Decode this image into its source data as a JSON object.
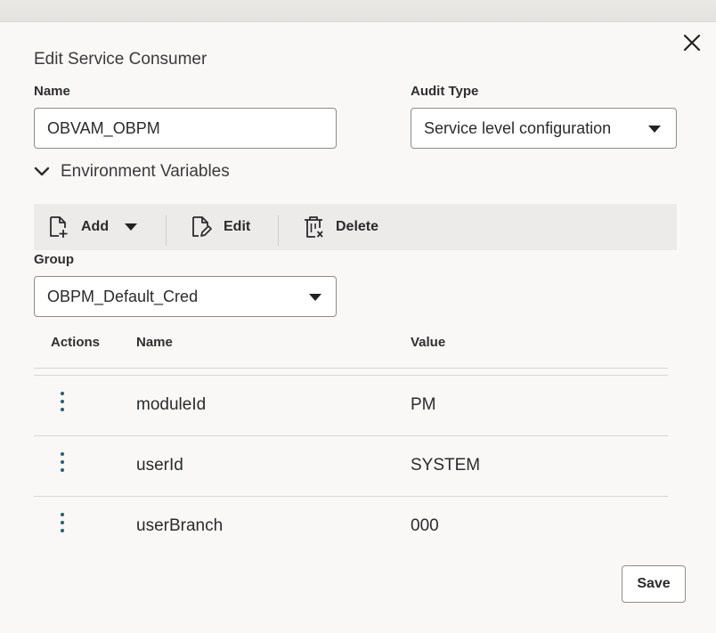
{
  "dialog": {
    "title": "Edit Service Consumer",
    "name_label": "Name",
    "name_value": "OBVAM_OBPM",
    "audit_label": "Audit Type",
    "audit_value": "Service level configuration",
    "env_section_label": "Environment Variables",
    "env_expanded": true
  },
  "toolbar": {
    "add_label": "Add",
    "edit_label": "Edit",
    "delete_label": "Delete"
  },
  "group": {
    "label": "Group",
    "value": "OBPM_Default_Cred"
  },
  "table": {
    "headers": {
      "actions": "Actions",
      "name": "Name",
      "value": "Value"
    },
    "rows": [
      {
        "name": "moduleId",
        "value": "PM"
      },
      {
        "name": "userId",
        "value": "SYSTEM"
      },
      {
        "name": "userBranch",
        "value": "000"
      }
    ]
  },
  "footer": {
    "save_label": "Save"
  },
  "icons": {
    "close": "close-icon",
    "expand": "chevron-down-icon",
    "add": "add-document-icon",
    "edit": "edit-document-icon",
    "delete": "delete-trash-icon",
    "row_actions": "kebab-menu-icon"
  },
  "colors": {
    "kebab": "#24607a",
    "toolbar_bg": "#ecebe9"
  }
}
